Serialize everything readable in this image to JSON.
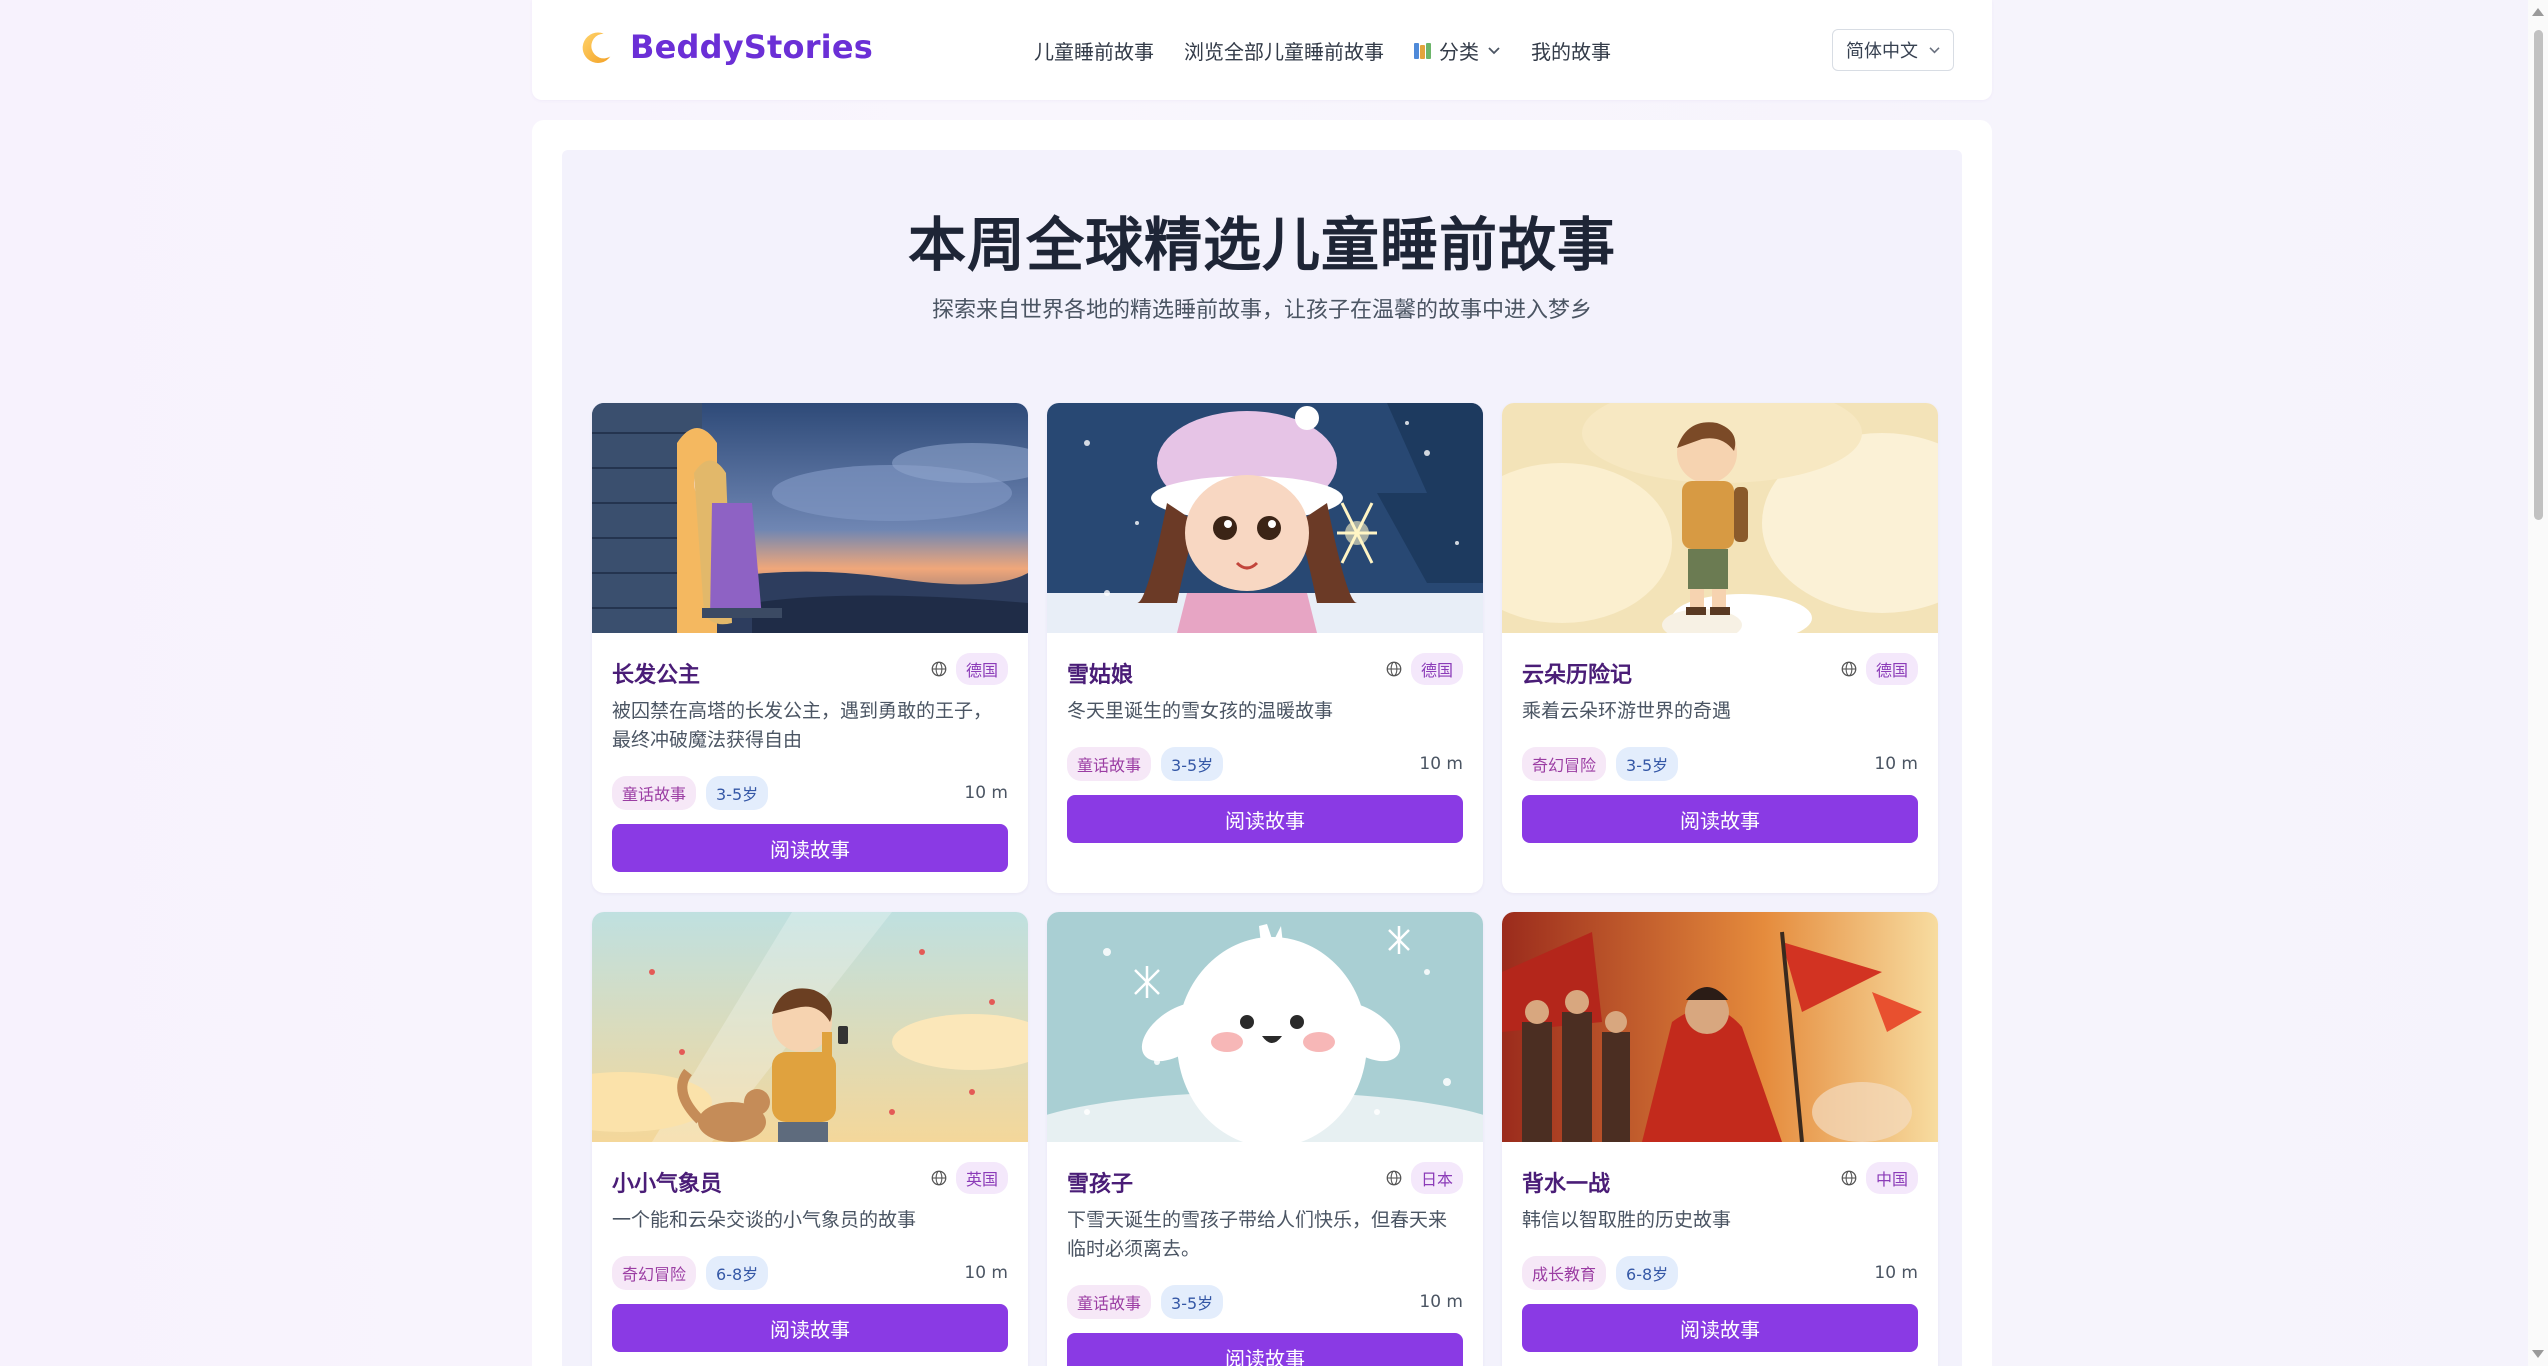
{
  "header": {
    "brand": "BeddyStories",
    "nav": [
      "儿童睡前故事",
      "浏览全部儿童睡前故事",
      "分类",
      "我的故事"
    ],
    "language": "简体中文"
  },
  "hero": {
    "title": "本周全球精选儿童睡前故事",
    "subtitle": "探索来自世界各地的精选睡前故事，让孩子在温馨的故事中进入梦乡"
  },
  "button_label": "阅读故事",
  "stories": [
    {
      "title": "长发公主",
      "country": "德国",
      "desc": "被囚禁在高塔的长发公主，遇到勇敢的王子，最终冲破魔法获得自由",
      "category": "童话故事",
      "age": "3-5岁",
      "duration": "10 m"
    },
    {
      "title": "雪姑娘",
      "country": "德国",
      "desc": "冬天里诞生的雪女孩的温暖故事",
      "category": "童话故事",
      "age": "3-5岁",
      "duration": "10 m"
    },
    {
      "title": "云朵历险记",
      "country": "德国",
      "desc": "乘着云朵环游世界的奇遇",
      "category": "奇幻冒险",
      "age": "3-5岁",
      "duration": "10 m"
    },
    {
      "title": "小小气象员",
      "country": "英国",
      "desc": "一个能和云朵交谈的小气象员的故事",
      "category": "奇幻冒险",
      "age": "6-8岁",
      "duration": "10 m"
    },
    {
      "title": "雪孩子",
      "country": "日本",
      "desc": "下雪天诞生的雪孩子带给人们快乐，但春天来临时必须离去。",
      "category": "童话故事",
      "age": "3-5岁",
      "duration": "10 m"
    },
    {
      "title": "背水一战",
      "country": "中国",
      "desc": "韩信以智取胜的历史故事",
      "category": "成长教育",
      "age": "6-8岁",
      "duration": "10 m"
    }
  ],
  "colors": {
    "accent": "#8a3ae4",
    "brand": "#6b2fd6",
    "title": "#4a1d77"
  }
}
